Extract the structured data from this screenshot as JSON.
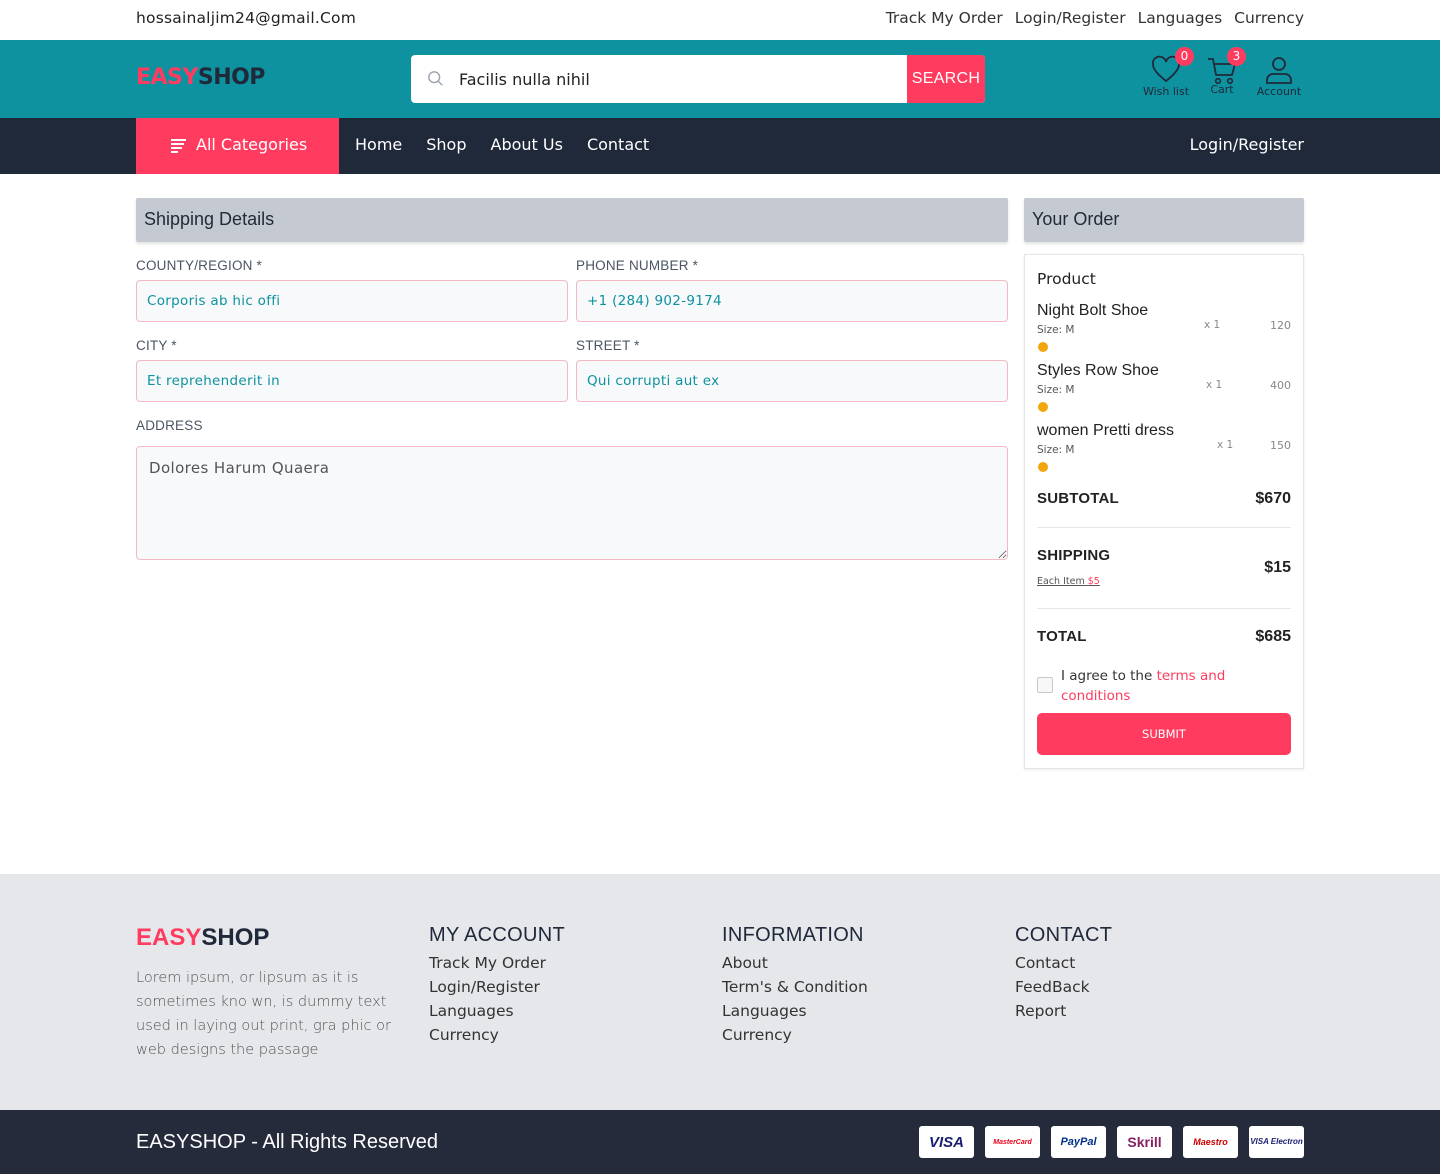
{
  "topbar": {
    "email": "hossainaljim24@gmail.Com",
    "links": [
      "Track My Order",
      "Login/Register",
      "Languages",
      "Currency"
    ]
  },
  "header": {
    "logo_a": "EASY",
    "logo_b": "SHOP",
    "search_value": "Facilis nulla nihil",
    "search_button": "SEARCH",
    "wishlist": {
      "label": "Wish list",
      "count": "0"
    },
    "cart": {
      "label": "Cart",
      "count": "3"
    },
    "account": {
      "label": "Account"
    }
  },
  "nav": {
    "all_categories": "All Categories",
    "menu": [
      "Home",
      "Shop",
      "About Us",
      "Contact"
    ],
    "login": "Login/Register"
  },
  "shipping": {
    "title": "Shipping Details",
    "county_label": "COUNTY/REGION *",
    "county_value": "Corporis ab hic offi",
    "phone_label": "PHONE NUMBER *",
    "phone_value": "+1 (284) 902-9174",
    "city_label": "CITY *",
    "city_value": "Et reprehenderit in",
    "street_label": "STREET *",
    "street_value": "Qui corrupti aut ex",
    "address_label": "ADDRESS",
    "address_value": "Dolores Harum Quaera"
  },
  "order": {
    "title": "Your Order",
    "product_heading": "Product",
    "items": [
      {
        "name": "Night Bolt Shoe",
        "size": "Size: M",
        "qty": "x 1",
        "price": "120",
        "color": "#f2a50c"
      },
      {
        "name": "Styles Row Shoe",
        "size": "Size: M",
        "qty": "x 1",
        "price": "400",
        "color": "#f2a50c"
      },
      {
        "name": "women Pretti dress",
        "size": "Size: M",
        "qty": "x 1",
        "price": "150",
        "color": "#f2a50c"
      }
    ],
    "subtotal_label": "SUBTOTAL",
    "subtotal_value": "$670",
    "shipping_label": "SHIPPING",
    "shipping_note": "Each Item",
    "shipping_note_price": "$5",
    "shipping_value": "$15",
    "total_label": "TOTAL",
    "total_value": "$685",
    "agree_text": "I agree to the ",
    "terms_text": "terms and conditions",
    "submit": "SUBMIT"
  },
  "footer": {
    "logo_a": "EASY",
    "logo_b": "SHOP",
    "description": "Lorem ipsum, or lipsum as it is sometimes kno wn, is dummy text used in laying out print, gra phic or web designs the passage",
    "columns": [
      {
        "title": "MY ACCOUNT",
        "links": [
          "Track My Order",
          "Login/Register",
          "Languages",
          "Currency"
        ]
      },
      {
        "title": "INFORMATION",
        "links": [
          "About",
          "Term's & Condition",
          "Languages",
          "Currency"
        ]
      },
      {
        "title": "CONTACT",
        "links": [
          "Contact",
          "FeedBack",
          "Report"
        ]
      }
    ],
    "copyright": "EASYSHOP - All Rights Reserved",
    "payment_cards": [
      {
        "label": "VISA",
        "color": "#1a1f71"
      },
      {
        "label": "MasterCard",
        "color": "#eb001b"
      },
      {
        "label": "PayPal",
        "color": "#003087"
      },
      {
        "label": "Skrill",
        "color": "#862165"
      },
      {
        "label": "Maestro",
        "color": "#cc0000"
      },
      {
        "label": "VISA Electron",
        "color": "#1a1f71"
      }
    ]
  },
  "colors": {
    "teal": "#0e929f",
    "accent": "#ff3c5f",
    "navy": "#20293a"
  }
}
